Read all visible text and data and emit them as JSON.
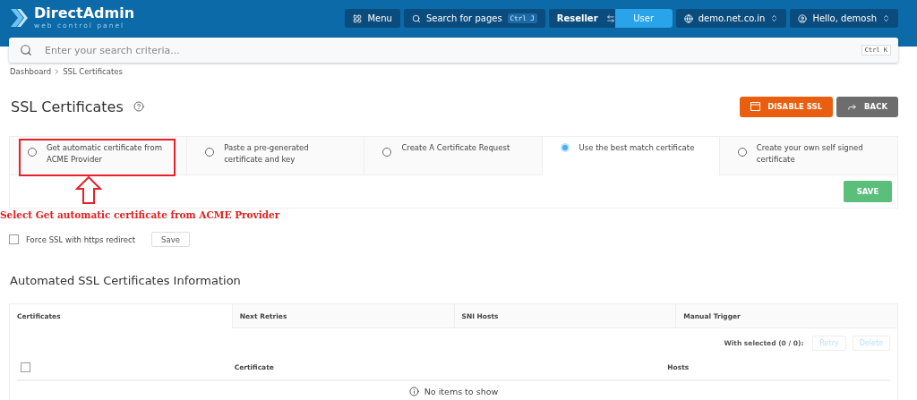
{
  "header": {
    "logo": {
      "title": "DirectAdmin",
      "subtitle": "web control panel"
    },
    "menu_button": "Menu",
    "page_search": {
      "label": "Search for pages",
      "shortcut": "Ctrl J"
    },
    "role_switch": [
      {
        "label": "Reseller",
        "selected": false
      },
      {
        "label": "User",
        "selected": true
      }
    ],
    "domain": "demo.net.co.in",
    "user": "Hello, demosh"
  },
  "search": {
    "placeholder": "Enter your search criteria...",
    "shortcut": "Ctrl K"
  },
  "breadcrumb": [
    "Dashboard",
    "SSL Certificates"
  ],
  "page_title": "SSL Certificates",
  "actions": [
    {
      "label": "DISABLE SSL",
      "kind": "danger"
    },
    {
      "label": "BACK",
      "kind": "back"
    }
  ],
  "options": [
    {
      "label": "Get automatic certificate from ACME Provider",
      "selected": false,
      "highlighted": true
    },
    {
      "label": "Paste a pre-generated certificate and key",
      "selected": false,
      "highlighted": false
    },
    {
      "label": "Create A Certificate Request",
      "selected": false,
      "highlighted": false
    },
    {
      "label": "Use the best match certificate",
      "selected": true,
      "highlighted": false
    },
    {
      "label": "Create your own self signed certificate",
      "selected": false,
      "highlighted": false
    }
  ],
  "save_button": "SAVE",
  "annotation": "Select Get automatic certificate from ACME Provider",
  "force_ssl": {
    "label": "Force SSL with https redirect",
    "checked": false,
    "save": "Save"
  },
  "section_title": "Automated SSL Certificates Information",
  "table": {
    "tabs": [
      {
        "label": "Certificates",
        "selected": true
      },
      {
        "label": "Next Retries",
        "selected": false
      },
      {
        "label": "SNI Hosts",
        "selected": false
      },
      {
        "label": "Manual Trigger",
        "selected": false
      }
    ],
    "with_selected": "With selected (0 / 0):",
    "actions": [
      {
        "label": "Retry",
        "disabled": true
      },
      {
        "label": "Delete",
        "disabled": true
      }
    ],
    "select_all": {
      "checked": false
    },
    "columns": [
      "Certificate",
      "Hosts"
    ],
    "empty": "No items to show"
  }
}
